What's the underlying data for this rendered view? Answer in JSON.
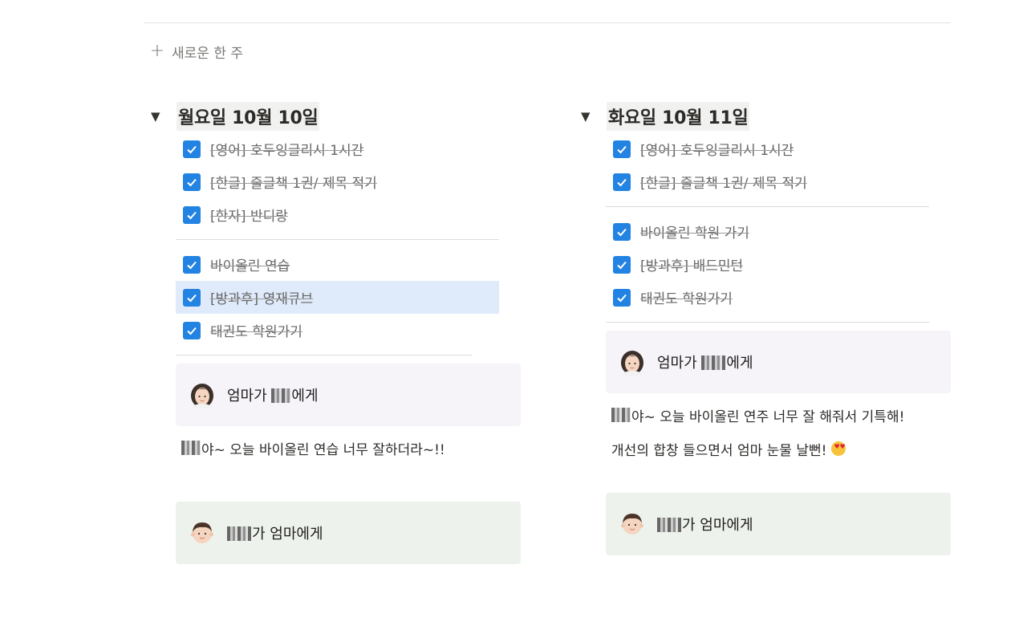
{
  "new_week": {
    "label": "새로운 한 주"
  },
  "days": [
    {
      "title": "월요일 10월 10일",
      "group1": [
        "[영어] 호두잉글리시 1시간",
        "[한글] 줄글책 1권/ 제목 적기",
        "[한자] 반디랑"
      ],
      "group2": [
        "바이올린 연습",
        "[방과후] 영재큐브",
        "태권도 학원가기"
      ],
      "mom_callout": {
        "prefix": "엄마가 ",
        "suffix": "에게"
      },
      "mom_message": [
        "야~ 오늘 바이올린 연습 너무 잘하더라~!!"
      ],
      "kid_callout": {
        "suffix": "가 엄마에게"
      }
    },
    {
      "title": "화요일 10월 11일",
      "group1": [
        "[영어] 호두잉글리시 1시간",
        "[한글] 줄글책 1권/ 제목 적기"
      ],
      "group2": [
        "바이올린 학원 가기",
        "[방과후] 배드민턴",
        "태권도 학원가기"
      ],
      "mom_callout": {
        "prefix": "엄마가 ",
        "suffix": "에게"
      },
      "mom_message": [
        "야~ 오늘 바이올린 연주 너무 잘 해줘서 기특해!",
        "개선의 합창 들으면서 엄마 눈물 날뻔!"
      ],
      "kid_callout": {
        "suffix": "가 엄마에게"
      }
    }
  ],
  "colors": {
    "checkbox": "#2383e2",
    "highlight": "#dfeafa",
    "mom_callout_bg": "#f6f3f9",
    "kid_callout_bg": "#edf3ec"
  },
  "icons": {
    "checkbox": "check-icon",
    "toggle": "triangle-down-icon",
    "add": "plus-icon",
    "mom": "woman-emoji-icon",
    "kid": "boy-emoji-icon",
    "heart_eyes": "heart-eyes-emoji-icon"
  }
}
